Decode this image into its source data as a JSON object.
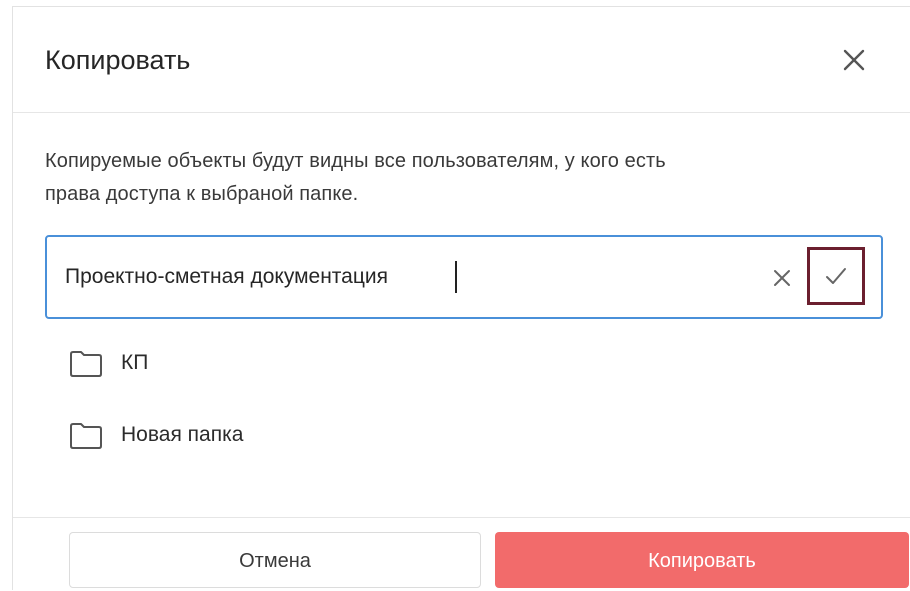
{
  "dialog": {
    "title": "Копировать",
    "description_line1": "Копируемые объекты будут видны все пользователям, у кого есть",
    "description_line2": "права доступа к выбраной папке."
  },
  "input": {
    "value": "Проектно-сметная документация",
    "clear_icon": "close-icon",
    "confirm_icon": "check-icon"
  },
  "folders": [
    {
      "label": "КП",
      "icon": "folder-icon"
    },
    {
      "label": "Новая папка",
      "icon": "folder-icon"
    }
  ],
  "footer": {
    "cancel_label": "Отмена",
    "copy_label": "Копировать"
  },
  "colors": {
    "input_border": "#4a90d9",
    "confirm_highlight": "#6b1f2e",
    "primary_button": "#f26b6b"
  }
}
